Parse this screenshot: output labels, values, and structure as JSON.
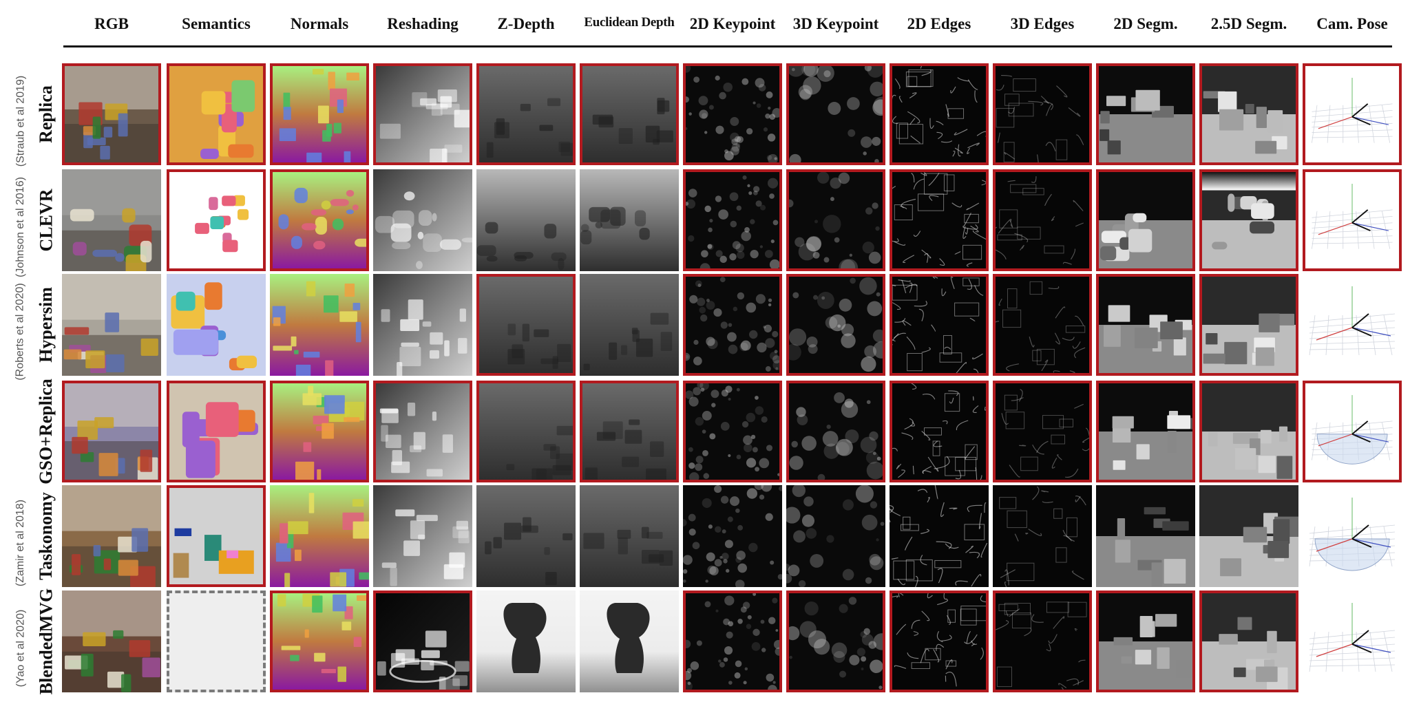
{
  "columns": [
    "RGB",
    "Semantics",
    "Normals",
    "Reshading",
    "Z-Depth",
    "Euclidean Depth",
    "2D Keypoint",
    "3D Keypoint",
    "2D Edges",
    "3D Edges",
    "2D Segm.",
    "2.5D Segm.",
    "Cam. Pose"
  ],
  "rows": [
    {
      "dataset": "Replica",
      "citation": "(Straub et al 2019)"
    },
    {
      "dataset": "CLEVR",
      "citation": "(Johnson et al 2016)"
    },
    {
      "dataset": "Hypersim",
      "citation": "(Roberts et al 2020)"
    },
    {
      "dataset": "GSO+Replica",
      "citation": ""
    },
    {
      "dataset": "Taskonomy",
      "citation": "(Zamir et al 2018)"
    },
    {
      "dataset": "BlendedMVG",
      "citation": "(Yao et al 2020)"
    }
  ],
  "cell_styles": [
    [
      "red",
      "red",
      "red",
      "red",
      "red",
      "red",
      "red",
      "red",
      "red",
      "red",
      "red",
      "red",
      "red"
    ],
    [
      "none",
      "red",
      "red",
      "none",
      "none",
      "none",
      "red",
      "red",
      "red",
      "red",
      "red",
      "red",
      "red"
    ],
    [
      "none",
      "none",
      "none",
      "none",
      "red",
      "none",
      "red",
      "red",
      "red",
      "red",
      "red",
      "red",
      "none"
    ],
    [
      "red",
      "red",
      "red",
      "red",
      "red",
      "red",
      "red",
      "red",
      "red",
      "red",
      "red",
      "red",
      "red"
    ],
    [
      "none",
      "red",
      "none",
      "none",
      "none",
      "none",
      "none",
      "none",
      "none",
      "none",
      "none",
      "none",
      "none"
    ],
    [
      "none",
      "dashed",
      "red",
      "red",
      "none",
      "none",
      "red",
      "red",
      "red",
      "red",
      "red",
      "red",
      "none"
    ]
  ],
  "colors": {
    "highlight_border": "#b21a1f",
    "missing_border": "#7a7a7a",
    "missing_fill": "#eeeeee",
    "rule": "#111111"
  }
}
